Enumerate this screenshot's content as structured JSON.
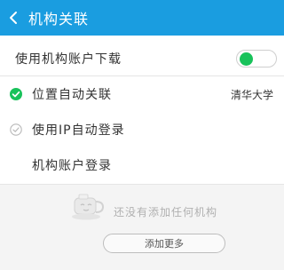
{
  "header": {
    "title": "机构关联"
  },
  "settings": {
    "use_institution_account_download": {
      "label": "使用机构账户下载",
      "enabled": true
    },
    "auto_link_by_location": {
      "label": "位置自动关联",
      "value": "清华大学",
      "checked": true
    },
    "auto_login_by_ip": {
      "label": "使用IP自动登录",
      "checked": false
    },
    "institution_account_login": {
      "label": "机构账户登录"
    }
  },
  "empty_state": {
    "message": "还没有添加任何机构",
    "add_more_label": "添加更多"
  },
  "colors": {
    "header_bg": "#1a9de0",
    "accent_green": "#18c25a"
  }
}
